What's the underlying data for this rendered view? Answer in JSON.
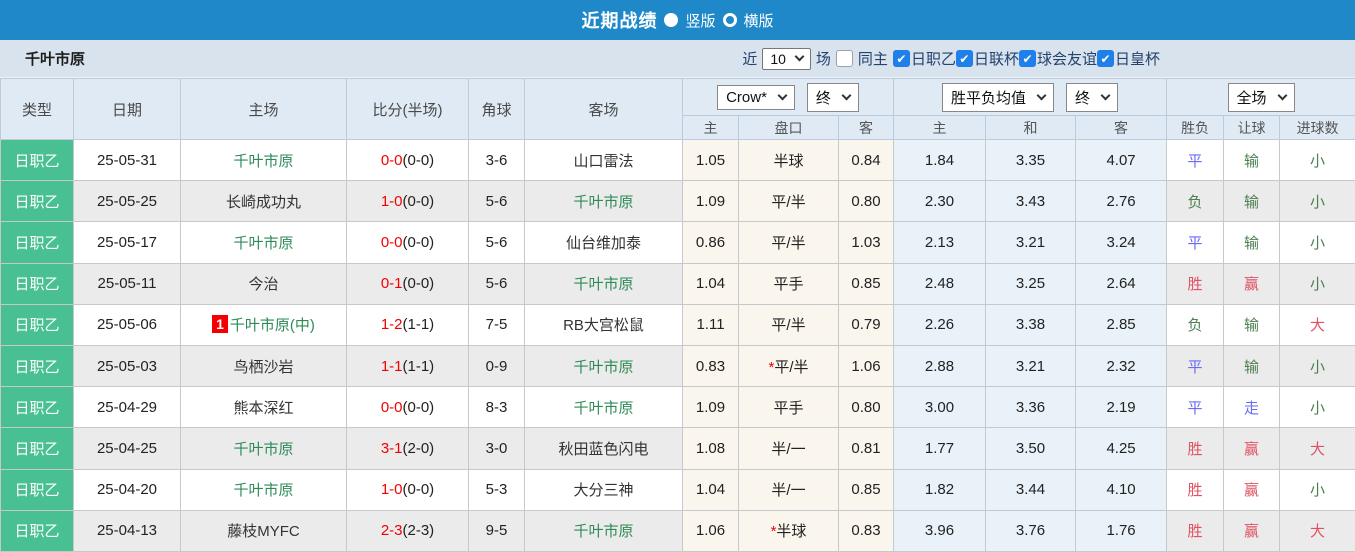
{
  "topbar": {
    "title": "近期战绩",
    "radio_vertical_label": "竖版",
    "radio_horizontal_label": "横版",
    "selected_option": "竖版"
  },
  "filterbar": {
    "team": "千叶市原",
    "near_label": "近",
    "count_value": "10",
    "games_label": "场",
    "same_home": {
      "label": "同主",
      "checked": false
    },
    "leagues": [
      {
        "label": "日职乙",
        "checked": true
      },
      {
        "label": "日联杯",
        "checked": true
      },
      {
        "label": "球会友谊",
        "checked": true
      },
      {
        "label": "日皇杯",
        "checked": true
      }
    ],
    "check_glyph": "✔"
  },
  "table": {
    "headers": {
      "type": "类型",
      "date": "日期",
      "home": "主场",
      "score": "比分(半场)",
      "corners": "角球",
      "away": "客场"
    },
    "selects": {
      "bookmaker": "Crow*",
      "bookmaker_time": "终",
      "avg": "胜平负均值",
      "avg_time": "终",
      "scope": "全场"
    },
    "sub_headers": [
      "主",
      "盘口",
      "客",
      "主",
      "和",
      "客",
      "胜负",
      "让球",
      "进球数"
    ],
    "rows": [
      {
        "league": "日职乙",
        "date": "25-05-31",
        "home": "千叶市原",
        "home_green": true,
        "first_badge": "",
        "score": "0-0",
        "half": "(0-0)",
        "corners": "3-6",
        "away": "山口雷法",
        "away_green": false,
        "odds_home": "1.05",
        "handicap": "半球",
        "handicap_star": false,
        "odds_away": "0.84",
        "avg_home": "1.84",
        "avg_draw": "3.35",
        "avg_away": "4.07",
        "result": {
          "t": "平",
          "c": "b"
        },
        "hresult": {
          "t": "输",
          "c": "g"
        },
        "goals": {
          "t": "小",
          "c": "g"
        }
      },
      {
        "league": "日职乙",
        "date": "25-05-25",
        "home": "长崎成功丸",
        "home_green": false,
        "first_badge": "",
        "score": "1-0",
        "half": "(0-0)",
        "corners": "5-6",
        "away": "千叶市原",
        "away_green": true,
        "odds_home": "1.09",
        "handicap": "平/半",
        "handicap_star": false,
        "odds_away": "0.80",
        "avg_home": "2.30",
        "avg_draw": "3.43",
        "avg_away": "2.76",
        "result": {
          "t": "负",
          "c": "g"
        },
        "hresult": {
          "t": "输",
          "c": "g"
        },
        "goals": {
          "t": "小",
          "c": "g"
        }
      },
      {
        "league": "日职乙",
        "date": "25-05-17",
        "home": "千叶市原",
        "home_green": true,
        "first_badge": "",
        "score": "0-0",
        "half": "(0-0)",
        "corners": "5-6",
        "away": "仙台维加泰",
        "away_green": false,
        "odds_home": "0.86",
        "handicap": "平/半",
        "handicap_star": false,
        "odds_away": "1.03",
        "avg_home": "2.13",
        "avg_draw": "3.21",
        "avg_away": "3.24",
        "result": {
          "t": "平",
          "c": "b"
        },
        "hresult": {
          "t": "输",
          "c": "g"
        },
        "goals": {
          "t": "小",
          "c": "g"
        }
      },
      {
        "league": "日职乙",
        "date": "25-05-11",
        "home": "今治",
        "home_green": false,
        "first_badge": "",
        "score": "0-1",
        "half": "(0-0)",
        "corners": "5-6",
        "away": "千叶市原",
        "away_green": true,
        "odds_home": "1.04",
        "handicap": "平手",
        "handicap_star": false,
        "odds_away": "0.85",
        "avg_home": "2.48",
        "avg_draw": "3.25",
        "avg_away": "2.64",
        "result": {
          "t": "胜",
          "c": "r"
        },
        "hresult": {
          "t": "赢",
          "c": "r"
        },
        "goals": {
          "t": "小",
          "c": "g"
        }
      },
      {
        "league": "日职乙",
        "date": "25-05-06",
        "home": "千叶市原(中)",
        "home_green": true,
        "first_badge": "1",
        "score": "1-2",
        "half": "(1-1)",
        "corners": "7-5",
        "away": "RB大宫松鼠",
        "away_green": false,
        "odds_home": "1.11",
        "handicap": "平/半",
        "handicap_star": false,
        "odds_away": "0.79",
        "avg_home": "2.26",
        "avg_draw": "3.38",
        "avg_away": "2.85",
        "result": {
          "t": "负",
          "c": "g"
        },
        "hresult": {
          "t": "输",
          "c": "g"
        },
        "goals": {
          "t": "大",
          "c": "r"
        }
      },
      {
        "league": "日职乙",
        "date": "25-05-03",
        "home": "鸟栖沙岩",
        "home_green": false,
        "first_badge": "",
        "score": "1-1",
        "half": "(1-1)",
        "corners": "0-9",
        "away": "千叶市原",
        "away_green": true,
        "odds_home": "0.83",
        "handicap": "平/半",
        "handicap_star": true,
        "odds_away": "1.06",
        "avg_home": "2.88",
        "avg_draw": "3.21",
        "avg_away": "2.32",
        "result": {
          "t": "平",
          "c": "b"
        },
        "hresult": {
          "t": "输",
          "c": "g"
        },
        "goals": {
          "t": "小",
          "c": "g"
        }
      },
      {
        "league": "日职乙",
        "date": "25-04-29",
        "home": "熊本深红",
        "home_green": false,
        "first_badge": "",
        "score": "0-0",
        "half": "(0-0)",
        "corners": "8-3",
        "away": "千叶市原",
        "away_green": true,
        "odds_home": "1.09",
        "handicap": "平手",
        "handicap_star": false,
        "odds_away": "0.80",
        "avg_home": "3.00",
        "avg_draw": "3.36",
        "avg_away": "2.19",
        "result": {
          "t": "平",
          "c": "b"
        },
        "hresult": {
          "t": "走",
          "c": "b"
        },
        "goals": {
          "t": "小",
          "c": "g"
        }
      },
      {
        "league": "日职乙",
        "date": "25-04-25",
        "home": "千叶市原",
        "home_green": true,
        "first_badge": "",
        "score": "3-1",
        "half": "(2-0)",
        "corners": "3-0",
        "away": "秋田蓝色闪电",
        "away_green": false,
        "odds_home": "1.08",
        "handicap": "半/一",
        "handicap_star": false,
        "odds_away": "0.81",
        "avg_home": "1.77",
        "avg_draw": "3.50",
        "avg_away": "4.25",
        "result": {
          "t": "胜",
          "c": "r"
        },
        "hresult": {
          "t": "赢",
          "c": "r"
        },
        "goals": {
          "t": "大",
          "c": "r"
        }
      },
      {
        "league": "日职乙",
        "date": "25-04-20",
        "home": "千叶市原",
        "home_green": true,
        "first_badge": "",
        "score": "1-0",
        "half": "(0-0)",
        "corners": "5-3",
        "away": "大分三神",
        "away_green": false,
        "odds_home": "1.04",
        "handicap": "半/一",
        "handicap_star": false,
        "odds_away": "0.85",
        "avg_home": "1.82",
        "avg_draw": "3.44",
        "avg_away": "4.10",
        "result": {
          "t": "胜",
          "c": "r"
        },
        "hresult": {
          "t": "赢",
          "c": "r"
        },
        "goals": {
          "t": "小",
          "c": "g"
        }
      },
      {
        "league": "日职乙",
        "date": "25-04-13",
        "home": "藤枝MYFC",
        "home_green": false,
        "first_badge": "",
        "score": "2-3",
        "half": "(2-3)",
        "corners": "9-5",
        "away": "千叶市原",
        "away_green": true,
        "odds_home": "1.06",
        "handicap": "半球",
        "handicap_star": true,
        "odds_away": "0.83",
        "avg_home": "3.96",
        "avg_draw": "3.76",
        "avg_away": "1.76",
        "result": {
          "t": "胜",
          "c": "r"
        },
        "hresult": {
          "t": "赢",
          "c": "r"
        },
        "goals": {
          "t": "大",
          "c": "r"
        }
      }
    ]
  },
  "colors": {
    "topbar_bg": "#1e88c8",
    "league_badge_bg": "#48c092",
    "team_green": "#2e8b57",
    "score_red": "#f50000",
    "result_text": {
      "r": "#e05263",
      "g": "#4d7f52",
      "b": "#6a6af2"
    }
  }
}
